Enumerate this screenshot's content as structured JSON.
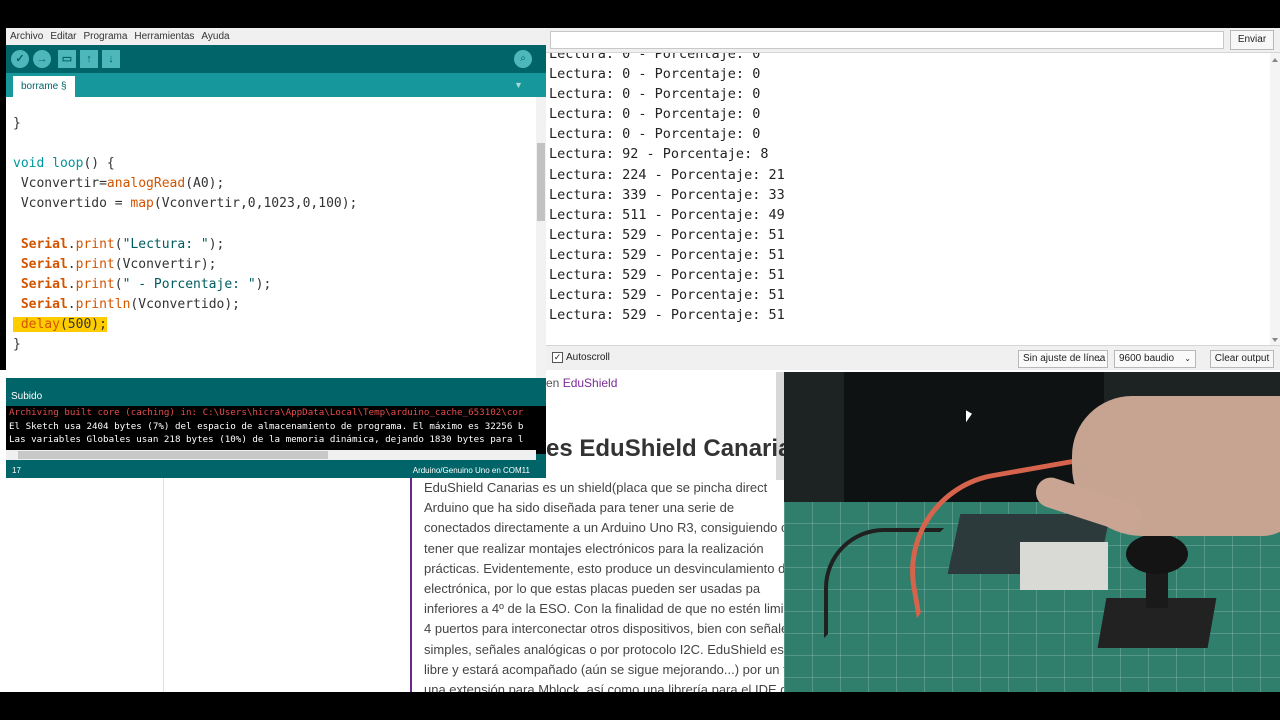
{
  "ide": {
    "menu": [
      "Archivo",
      "Editar",
      "Programa",
      "Herramientas",
      "Ayuda"
    ],
    "toolbar": {
      "verify_icon": "check-icon",
      "upload_icon": "arrow-right-icon",
      "new_icon": "file-icon",
      "open_icon": "arrow-up-icon",
      "save_icon": "arrow-down-icon",
      "serial_monitor_icon": "magnifier-icon"
    },
    "tab_label": "borrame §",
    "console_status": "Subido",
    "console_lines": [
      "Archiving built core (caching) in: C:\\Users\\hicra\\AppData\\Local\\Temp\\arduino_cache_653102\\cor",
      "El Sketch usa 2404 bytes (7%) del espacio de almacenamiento de programa. El máximo es 32256 b",
      "Las variables Globales usan 218 bytes (10%) de la memoria dinámica, dejando 1830 bytes para l"
    ],
    "status_line": "17",
    "status_board": "Arduino/Genuino Uno en COM11"
  },
  "code": {
    "l1": "}",
    "l3a": "void",
    "l3b": "loop",
    "l3c": "() {",
    "l4a": "Vconvertir=",
    "l4b": "analogRead",
    "l4c": "(A0);",
    "l5a": "Vconvertido = ",
    "l5b": "map",
    "l5c": "(Vconvertir,0,1023,0,100);",
    "l7a": "Serial",
    "l7b": ".",
    "l7c": "print",
    "l7d": "(",
    "l7e": "\"Lectura: \"",
    "l7f": ");",
    "l8a": "Serial",
    "l8b": ".",
    "l8c": "print",
    "l8d": "(Vconvertir);",
    "l9a": "Serial",
    "l9b": ".",
    "l9c": "print",
    "l9d": "(",
    "l9e": "\" - Porcentaje: \"",
    "l9f": ");",
    "l10a": "Serial",
    "l10b": ".",
    "l10c": "println",
    "l10d": "(Vconvertido);",
    "l11a": "delay",
    "l11b": "(500);",
    "l12": "}"
  },
  "serial": {
    "send_label": "Enviar",
    "lines": [
      "Lectura: 0 - Porcentaje: 0",
      "Lectura: 0 - Porcentaje: 0",
      "Lectura: 0 - Porcentaje: 0",
      "Lectura: 0 - Porcentaje: 0",
      "Lectura: 0 - Porcentaje: 0",
      "Lectura: 92 - Porcentaje: 8",
      "Lectura: 224 - Porcentaje: 21",
      "Lectura: 339 - Porcentaje: 33",
      "Lectura: 511 - Porcentaje: 49",
      "Lectura: 529 - Porcentaje: 51",
      "Lectura: 529 - Porcentaje: 51",
      "Lectura: 529 - Porcentaje: 51",
      "Lectura: 529 - Porcentaje: 51",
      "Lectura: 529 - Porcentaje: 51"
    ],
    "autoscroll_label": "Autoscroll",
    "autoscroll_checked": true,
    "line_ending": "Sin ajuste de línea",
    "baud": "9600 baudio",
    "clear_label": "Clear output"
  },
  "webpage": {
    "breadcrumb_prefix": "en ",
    "breadcrumb_link": "EduShield",
    "title": "es EduShield Canarias",
    "paragraph": [
      "EduShield Canarias es un shield(placa que se pincha direct",
      "Arduino que ha sido diseñada para tener una serie de",
      "conectados directamente a un Arduino Uno R3, consiguiendo c",
      "tener que realizar montajes electrónicos para la realización",
      "prácticas. Evidentemente, esto produce un desvinculamiento d",
      "electrónica, por lo que estas placas pueden ser usadas pa",
      "inferiores a 4º de la ESO. Con la finalidad de que no estén  limitad",
      "4 puertos para interconectar otros dispositivos, bien con señale",
      "simples, señales analógicas o por protocolo I2C. EduShield es",
      "libre y estará acompañado (aún se sigue mejorando...) por un f",
      "una extensión para Mblock, así como una librería para el IDE d"
    ],
    "link_color": "#7a2a9a"
  },
  "colors": {
    "ide_teal": "#006468",
    "ide_tab": "#16979c",
    "keyword_orange": "#d35400",
    "highlight": "#ffcc00"
  }
}
